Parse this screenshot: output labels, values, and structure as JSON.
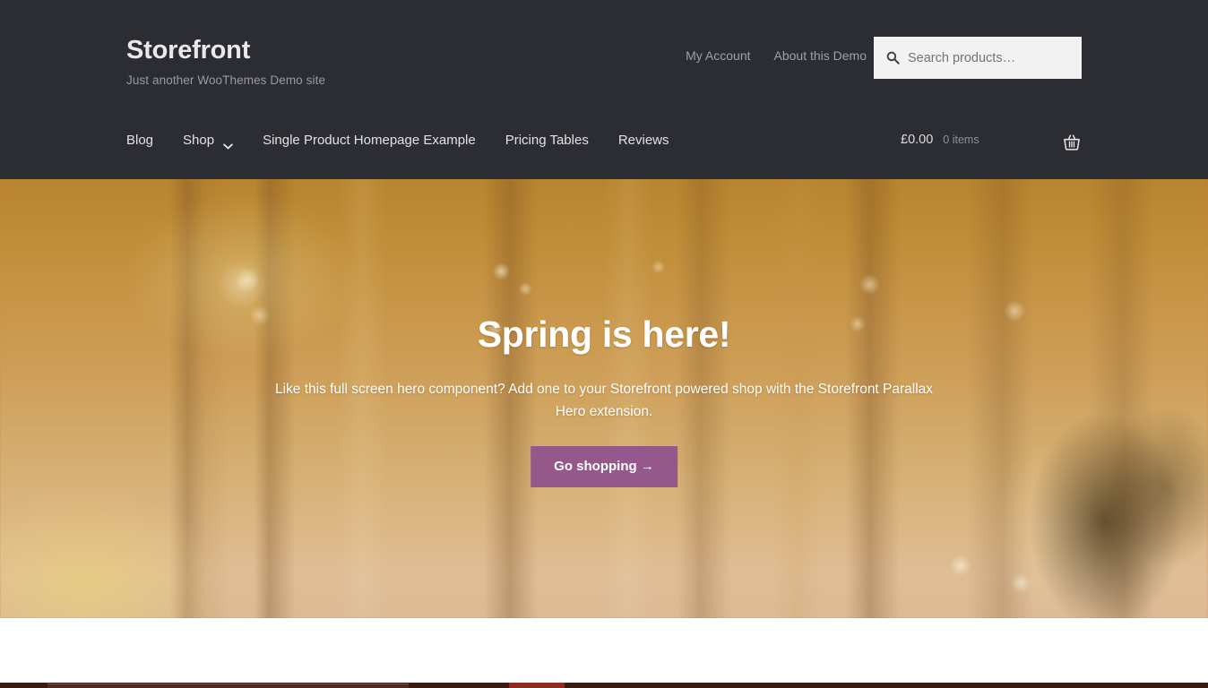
{
  "header": {
    "site_title": "Storefront",
    "tagline": "Just another WooThemes Demo site",
    "background_color": "#2c2d33",
    "secondary_nav": [
      {
        "label": "My Account"
      },
      {
        "label": "About this Demo"
      }
    ],
    "search": {
      "placeholder": "Search products…",
      "value": "",
      "icon": "search-icon"
    },
    "primary_nav": [
      {
        "label": "Blog",
        "has_dropdown": false
      },
      {
        "label": "Shop",
        "has_dropdown": true,
        "dropdown_icon": "chevron-down-icon"
      },
      {
        "label": "Single Product Homepage Example",
        "has_dropdown": false
      },
      {
        "label": "Pricing Tables",
        "has_dropdown": false
      },
      {
        "label": "Reviews",
        "has_dropdown": false
      }
    ],
    "cart": {
      "amount": "£0.00",
      "count": "0 items",
      "icon": "shopping-basket-icon"
    }
  },
  "hero": {
    "title": "Spring is here!",
    "text": "Like this full screen hero component? Add one to your Storefront powered shop with the Storefront Parallax Hero extension.",
    "button_label": "Go shopping →",
    "button_color": "#96588a",
    "text_color": "#ffffff"
  },
  "colors": {
    "header_bg": "#2c2d33",
    "accent_purple": "#96588a",
    "search_bg": "#f2f2f2",
    "body_bg": "#ffffff",
    "os_bar": "#3a1b13"
  }
}
